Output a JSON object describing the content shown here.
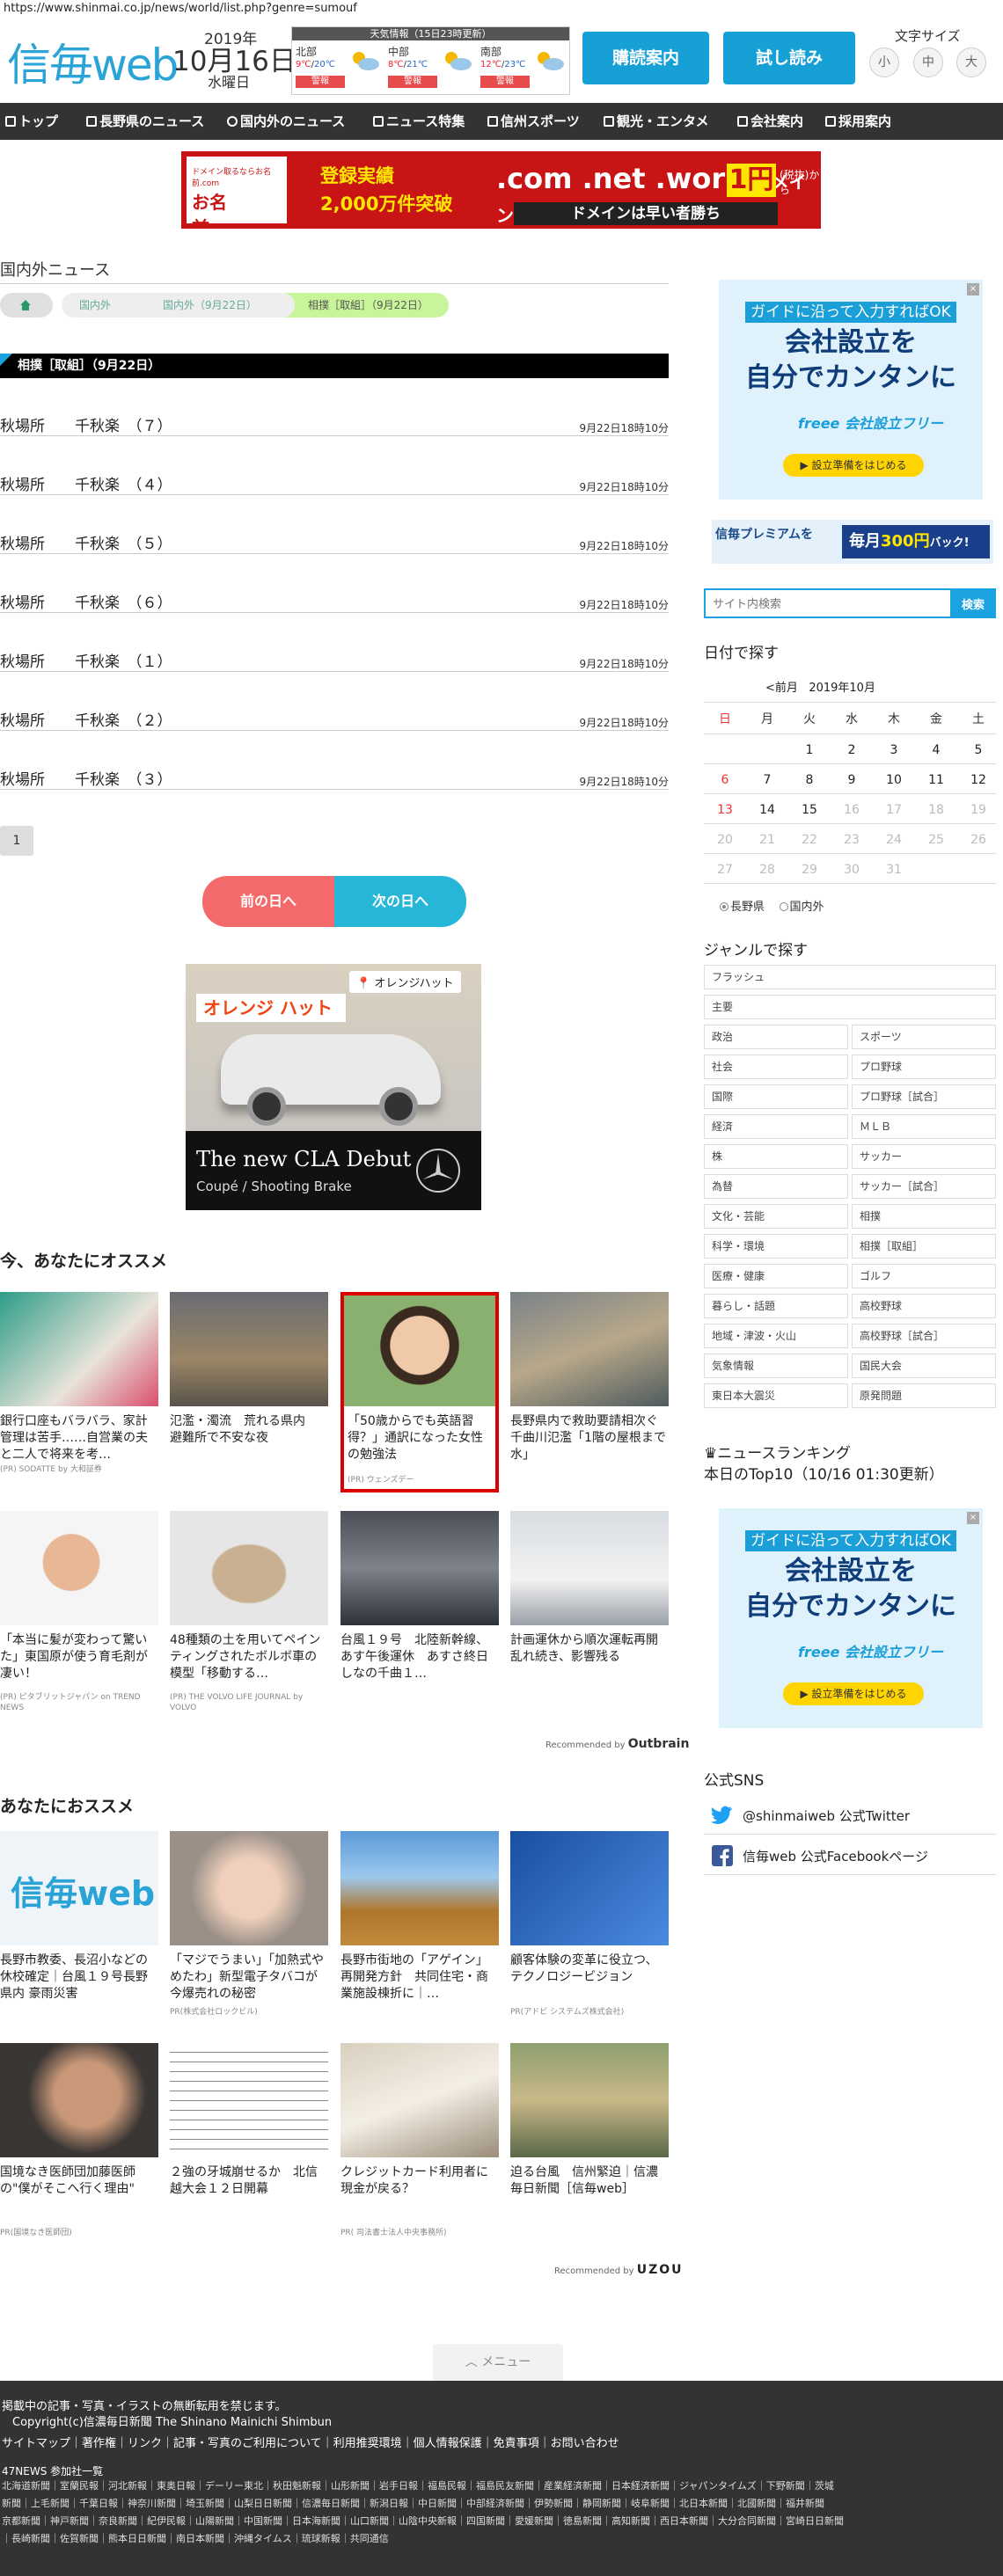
{
  "url": "https://www.shinmai.co.jp/news/world/list.php?genre=sumouf",
  "header": {
    "logo": "信毎",
    "logo_web": "web",
    "year": "2019年",
    "month_day": "10月16日",
    "weekday": "水曜日",
    "weather_title": "天気情報（15日23時更新）",
    "weather": [
      {
        "region": "北部",
        "hi": "9℃",
        "lo": "20℃",
        "alert": "警報"
      },
      {
        "region": "中部",
        "hi": "8℃",
        "lo": "21℃",
        "alert": "警報"
      },
      {
        "region": "南部",
        "hi": "12℃",
        "lo": "23℃",
        "alert": "警報"
      }
    ],
    "subscribe_label": "購読案内",
    "trial_label": "試し読み",
    "fontsize_label": "文字サイズ",
    "fontsize_small": "小",
    "fontsize_medium": "中",
    "fontsize_large": "大"
  },
  "nav": [
    {
      "label": "トップ"
    },
    {
      "label": "長野県のニュース"
    },
    {
      "label": "国内外のニュース"
    },
    {
      "label": "ニュース特集"
    },
    {
      "label": "信州スポーツ"
    },
    {
      "label": "観光・エンタメ"
    },
    {
      "label": "会社案内"
    },
    {
      "label": "採用案内"
    }
  ],
  "top_banner": {
    "small": "ドメイン取るならお名前.com",
    "brand": "お名前.com",
    "line1": "登録実績",
    "line2": "2,000万件突破",
    "domains": ".com .net .work",
    "domain_word": "ドメイン",
    "price": "1円",
    "price_note": "(税抜)から",
    "tagline": "ドメインは早い者勝ち"
  },
  "main": {
    "section_title": "国内外ニュース",
    "breadcrumb": [
      "国内外",
      "国内外（9月22日）",
      "相撲［取組］（9月22日）"
    ],
    "list_heading": "相撲［取組］（9月22日）",
    "items": [
      {
        "title": "秋場所　　千秋楽　（７）",
        "date": "9月22日18時10分"
      },
      {
        "title": "秋場所　　千秋楽　（４）",
        "date": "9月22日18時10分"
      },
      {
        "title": "秋場所　　千秋楽　（５）",
        "date": "9月22日18時10分"
      },
      {
        "title": "秋場所　　千秋楽　（６）",
        "date": "9月22日18時10分"
      },
      {
        "title": "秋場所　　千秋楽　（１）",
        "date": "9月22日18時10分"
      },
      {
        "title": "秋場所　　千秋楽　（２）",
        "date": "9月22日18時10分"
      },
      {
        "title": "秋場所　　千秋楽　（３）",
        "date": "9月22日18時10分"
      }
    ],
    "page": "1",
    "prev_day": "前の日へ",
    "next_day": "次の日へ"
  },
  "merc_ad": {
    "pin": "オレンジハット",
    "sign": "オレンジ ハット",
    "headline": "The new CLA Debut",
    "sub": "Coupé / Shooting Brake"
  },
  "recommend1": {
    "title": "今、あなたにオススメ",
    "cards": [
      {
        "text": "銀行口座もバラバラ、家計管理は苦手……自営業の夫と二人で将来を考…",
        "src": "(PR) SODATTE by 大和証券"
      },
      {
        "text": "氾濫・濁流　荒れる県内　避難所で不安な夜",
        "src": ""
      },
      {
        "text": "「50歳からでも英語習得？」通訳になった女性の勉強法",
        "src": "(PR) ウェンズデー"
      },
      {
        "text": "長野県内で救助要請相次ぐ　千曲川氾濫「1階の屋根まで水」",
        "src": ""
      },
      {
        "text": "「本当に髪が変わって驚いた」東国原が使う育毛剤が凄い！",
        "src": "(PR) ピタブリットジャパン on TREND NEWS"
      },
      {
        "text": "48種類の土を用いてペインティングされたボルボ車の模型「移動する…",
        "src": "(PR) THE VOLVO LIFE JOURNAL by VOLVO"
      },
      {
        "text": "台風１９号　北陸新幹線、あす午後運休　あすさ終日　しなの千曲１…",
        "src": ""
      },
      {
        "text": "計画運休から順次運転再開　乱れ続き、影響残る",
        "src": ""
      }
    ],
    "recommended_by": "Recommended by",
    "brand": "Outbrain"
  },
  "recommend2": {
    "title": "あなたにおススメ",
    "cards": [
      {
        "text": "長野市教委、長沼小などの休校確定｜台風１９号長野県内 豪雨災害",
        "src": ""
      },
      {
        "text": "「マジでうまい」「加熱式やめたわ」新型電子タバコが今爆売れの秘密",
        "src": "PR(株式会社ロックビル)"
      },
      {
        "text": "長野市街地の「アゲイン」再開発方針　共同住宅・商業施設棟折に｜…",
        "src": ""
      },
      {
        "text": "顧客体験の変革に役立つ、テクノロジービジョン",
        "src": "PR(アドビ システムズ株式会社)"
      },
      {
        "text": "国境なき医師団加藤医師の\"僕がそこへ行く理由\"",
        "src": "PR(国境なき医師団)"
      },
      {
        "text": "２強の牙城崩せるか　北信越大会１２日開幕",
        "src": ""
      },
      {
        "text": "クレジットカード利用者に現金が戻る？",
        "src": "PR( 司法書士法人中央事務所)"
      },
      {
        "text": "迫る台風　信州緊迫｜信濃毎日新聞［信毎web］",
        "src": ""
      }
    ],
    "recommended_by": "Recommended by",
    "brand": "UZOU"
  },
  "menu_label": "メニュー",
  "sidebar": {
    "ad1": {
      "l1": "ガイドに沿って入力すればOK",
      "l2a": "会社設立を",
      "l2b": "自分でカンタンに",
      "logo": "freee 会社設立フリー",
      "cta": "▶ 設立準備をはじめる"
    },
    "premium": {
      "p1": "信毎プレミアムを",
      "p2a": "毎月",
      "p2b": "300円",
      "p2c": "バック!"
    },
    "search_placeholder": "サイト内検索",
    "search_button": "検索",
    "day_title": "日付で探す",
    "cal_prev": "<前月",
    "cal_month": "2019年10月",
    "dow": [
      "日",
      "月",
      "火",
      "水",
      "木",
      "金",
      "土"
    ],
    "weeks": [
      [
        "",
        "",
        "1",
        "2",
        "3",
        "4",
        "5"
      ],
      [
        "6",
        "7",
        "8",
        "9",
        "10",
        "11",
        "12"
      ],
      [
        "13",
        "14",
        "15",
        "16",
        "17",
        "18",
        "19"
      ],
      [
        "20",
        "21",
        "22",
        "23",
        "24",
        "25",
        "26"
      ],
      [
        "27",
        "28",
        "29",
        "30",
        "31",
        "",
        ""
      ]
    ],
    "region_nagano": "長野県",
    "region_domestic": "国内外",
    "genre_title": "ジャンルで探す",
    "genres_full": [
      "フラッシュ",
      "主要"
    ],
    "genres": [
      [
        "政治",
        "スポーツ"
      ],
      [
        "社会",
        "プロ野球"
      ],
      [
        "国際",
        "プロ野球［試合］"
      ],
      [
        "経済",
        "ＭＬＢ"
      ],
      [
        "株",
        "サッカー"
      ],
      [
        "為替",
        "サッカー［試合］"
      ],
      [
        "文化・芸能",
        "相撲"
      ],
      [
        "科学・環境",
        "相撲［取組］"
      ],
      [
        "医療・健康",
        "ゴルフ"
      ],
      [
        "暮らし・話題",
        "高校野球"
      ],
      [
        "地域・津波・火山",
        "高校野球［試合］"
      ],
      [
        "気象情報",
        "国民大会"
      ],
      [
        "東日本大震災",
        "原発問題"
      ]
    ],
    "ranking_title": "ニュースランキング",
    "ranking_sub": "本日のTop10（10/16 01:30更新）",
    "sns_title": "公式SNS",
    "twitter": "@shinmaiweb 公式Twitter",
    "facebook": "信毎web 公式Facebookページ"
  },
  "footer": {
    "notice": "掲載中の記事・写真・イラストの無断転用を禁じます。",
    "copyright": "Copyright(c)信濃毎日新聞 The Shinano Mainichi Shimbun",
    "links": "サイトマップ｜著作権｜リンク｜記事・写真のご利用について｜利用推奨環境｜個人情報保護｜免責事項｜お問い合わせ",
    "news47": "47NEWS 参加社一覧",
    "members1": "北海道新聞｜室蘭民報｜河北新報｜東奥日報｜デーリー東北｜秋田魁新報｜山形新聞｜岩手日報｜福島民報｜福島民友新聞｜産業経済新聞｜日本経済新聞｜ジャパンタイムズ｜下野新聞｜茨城",
    "members2": "新聞｜上毛新聞｜千葉日報｜神奈川新聞｜埼玉新聞｜山梨日日新聞｜信濃毎日新聞｜新潟日報｜中日新聞｜中部経済新聞｜伊勢新聞｜静岡新聞｜岐阜新聞｜北日本新聞｜北國新聞｜福井新聞",
    "members3": "京都新聞｜神戸新聞｜奈良新聞｜紀伊民報｜山陽新聞｜中国新聞｜日本海新聞｜山口新聞｜山陰中央新報｜四国新聞｜愛媛新聞｜徳島新聞｜高知新聞｜西日本新聞｜大分合同新聞｜宮崎日日新聞",
    "members4": "｜長崎新聞｜佐賀新聞｜熊本日日新聞｜南日本新聞｜沖縄タイムス｜琉球新報｜共同通信"
  },
  "colors": {
    "brand": "#2aa3d6",
    "nav": "#333333",
    "prev": "#f46a6a",
    "next": "#26b6d8",
    "alert": "#e74c4c"
  }
}
